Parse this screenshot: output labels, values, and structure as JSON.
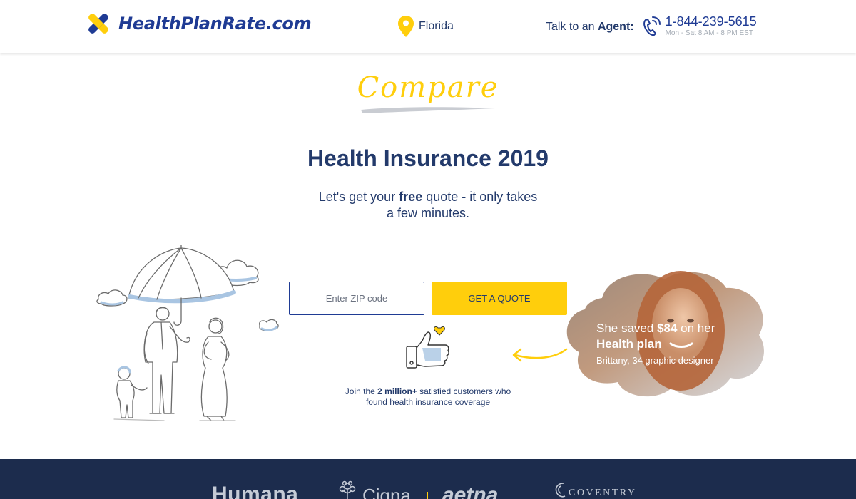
{
  "header": {
    "logo_text": "HealthPlanRate.com",
    "location": "Florida",
    "agent_prefix": "Talk to an",
    "agent_bold": "Agent:",
    "phone": "1-844-239-5615",
    "hours": "Mon - Sat 8 AM - 8 PM EST"
  },
  "hero": {
    "compare": "Compare",
    "headline": "Health Insurance 2019",
    "sub_before": "Let's get your ",
    "sub_bold": "free",
    "sub_after": " quote - it only takes a few minutes."
  },
  "form": {
    "zip_placeholder": "Enter ZIP code",
    "zip_value": "",
    "button_label": "GET A QUOTE"
  },
  "social_proof": {
    "before": "Join the ",
    "bold": "2 million+",
    "after": " satisfied customers who found health insurance coverage"
  },
  "testimonial": {
    "line1_before": "She saved ",
    "amount": "$84",
    "line1_after": " on her",
    "line2": "Health plan",
    "line3": "Brittany, 34  graphic designer"
  },
  "brands": [
    "Humana",
    "Cigna",
    "aetna",
    "COVENTRY"
  ],
  "colors": {
    "navy": "#233a6b",
    "accent_yellow": "#ffce0c",
    "footer_bg": "#1c2c4d",
    "logo_blue": "#1f3b94"
  }
}
